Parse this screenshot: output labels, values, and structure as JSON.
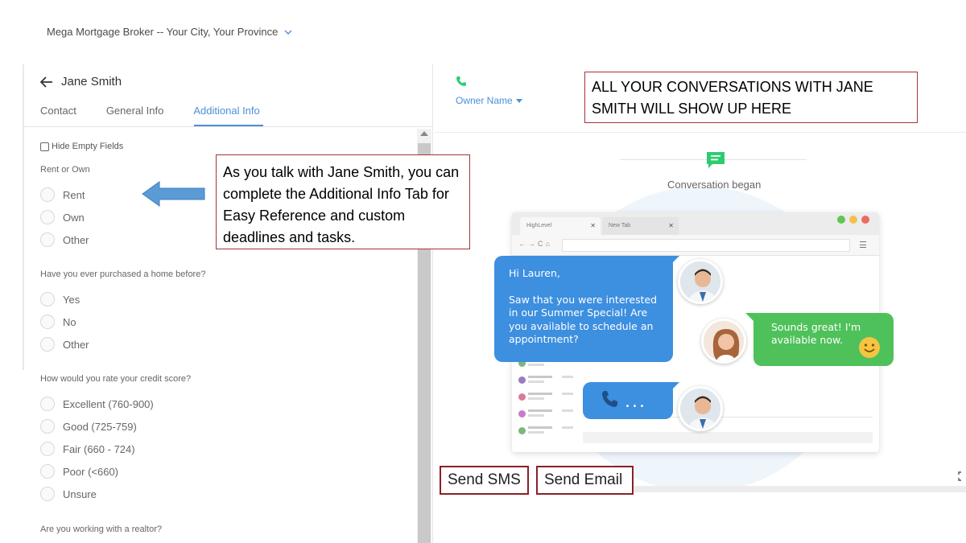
{
  "header": {
    "company": "Mega Mortgage Broker -- Your City, Your Province"
  },
  "contact": {
    "name": "Jane Smith",
    "tabs": [
      {
        "label": "Contact"
      },
      {
        "label": "General Info"
      },
      {
        "label": "Additional Info",
        "active": true
      }
    ],
    "hide_empty_label": "Hide Empty Fields"
  },
  "form": {
    "q1": {
      "label": "Rent or Own",
      "options": [
        "Rent",
        "Own",
        "Other"
      ]
    },
    "q2": {
      "label": "Have you ever purchased a home before?",
      "options": [
        "Yes",
        "No",
        "Other"
      ]
    },
    "q3": {
      "label": "How would you rate your credit score?",
      "options": [
        "Excellent (760-900)",
        "Good (725-759)",
        "Fair (660 - 724)",
        "Poor (<660)",
        "Unsure"
      ]
    },
    "q4": {
      "label": "Are you working with a realtor?"
    }
  },
  "annotations": {
    "left_callout": "As you talk with Jane Smith, you can complete the Additional Info Tab for Easy Reference and custom deadlines and tasks.",
    "top_callout": "ALL YOUR CONVERSATIONS WITH JANE SMITH WILL SHOW UP HERE"
  },
  "conversation": {
    "owner_label": "Owner Name",
    "began_label": "Conversation began",
    "browser_tabs": [
      "HighLevel",
      "New Tab"
    ],
    "bubble_blue_greeting": "Hi Lauren,",
    "bubble_blue_body": "Saw that you were interested in our Summer Special! Are you available to schedule an appointment?",
    "bubble_green": "Sounds great! I'm available now.",
    "call_dots": "..."
  },
  "actions": {
    "send_sms": "Send SMS",
    "send_email": "Send Email"
  },
  "colors": {
    "accent_blue": "#4a90d9",
    "callout_border": "#a3333a",
    "bubble_blue": "#3d8fe0",
    "bubble_green": "#4fc15a",
    "phone_green": "#2ecc71"
  }
}
